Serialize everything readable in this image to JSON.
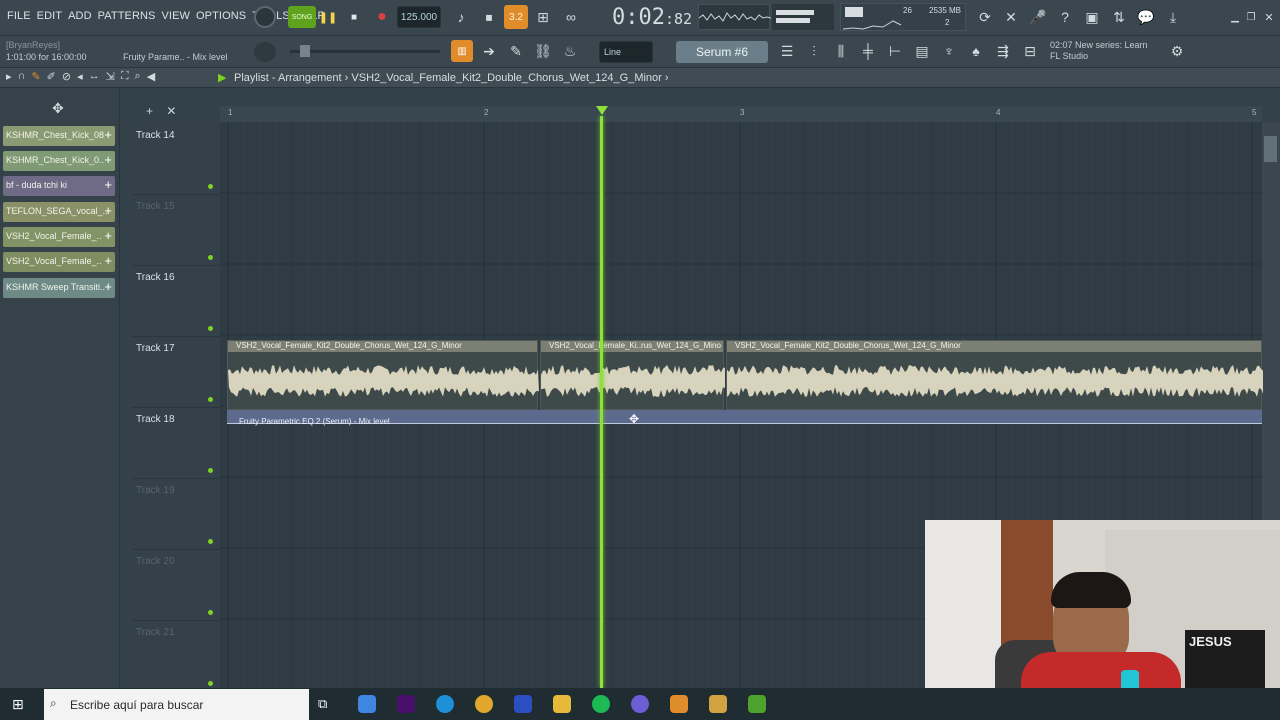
{
  "menu": [
    "FILE",
    "EDIT",
    "ADD",
    "PATTERNS",
    "VIEW",
    "OPTIONS",
    "TOOLS",
    "HELP"
  ],
  "transport": {
    "song_label": "SONG",
    "tempo": "125.000",
    "time_main": "0:02",
    "time_sub": "82",
    "count": "3.2"
  },
  "hints": {
    "user": "[BryanReyes]",
    "position": "1:01:00 for 16:00:00",
    "hint": "Fruity Parame.. - Mix level"
  },
  "snap": "Line",
  "channel": "Serum #6",
  "cpu": {
    "mb": "2535 MB",
    "n1": "26",
    "n2": "2"
  },
  "news": {
    "line1": "02:07  New series: Learn",
    "line2": "FL Studio"
  },
  "playlist": {
    "title": "Playlist - Arrangement",
    "pattern": "VSH2_Vocal_Female_Kit2_Double_Chorus_Wet_124_G_Minor"
  },
  "left_clips": [
    {
      "label": "KSHMR_Chest_Kick_08",
      "color": "#8a9b73"
    },
    {
      "label": "KSHMR_Chest_Kick_0..",
      "color": "#7f9a75"
    },
    {
      "label": "bf - duda tchi ki",
      "color": "#6f6b86"
    },
    {
      "label": "TEFLON_SEGA_vocal_..",
      "color": "#8a9068"
    },
    {
      "label": "VSH2_Vocal_Female_..",
      "color": "#829465"
    },
    {
      "label": "VSH2_Vocal_Female_..",
      "color": "#7f8e60"
    },
    {
      "label": "KSHMR Sweep Transiti..",
      "color": "#6e8a86"
    }
  ],
  "tracks": [
    "Track 14",
    "Track 15",
    "Track 16",
    "Track 17",
    "Track 18",
    "Track 19",
    "Track 20",
    "Track 21"
  ],
  "ruler": [
    "1",
    "2",
    "3",
    "4",
    "5"
  ],
  "clips": [
    {
      "label": "VSH2_Vocal_Female_Kit2_Double_Chorus_Wet_124_G_Minor"
    },
    {
      "label": "VSH2_Vocal_Female_Ki..rus_Wet_124_G_Mino"
    },
    {
      "label": "VSH2_Vocal_Female_Kit2_Double_Chorus_Wet_124_G_Minor"
    }
  ],
  "automation_clip": "Fruity Parametric EQ 2 (Serum) - Mix level",
  "taskbar": {
    "search_placeholder": "Escribe aquí para buscar"
  },
  "webcam_sign": "JESUS"
}
